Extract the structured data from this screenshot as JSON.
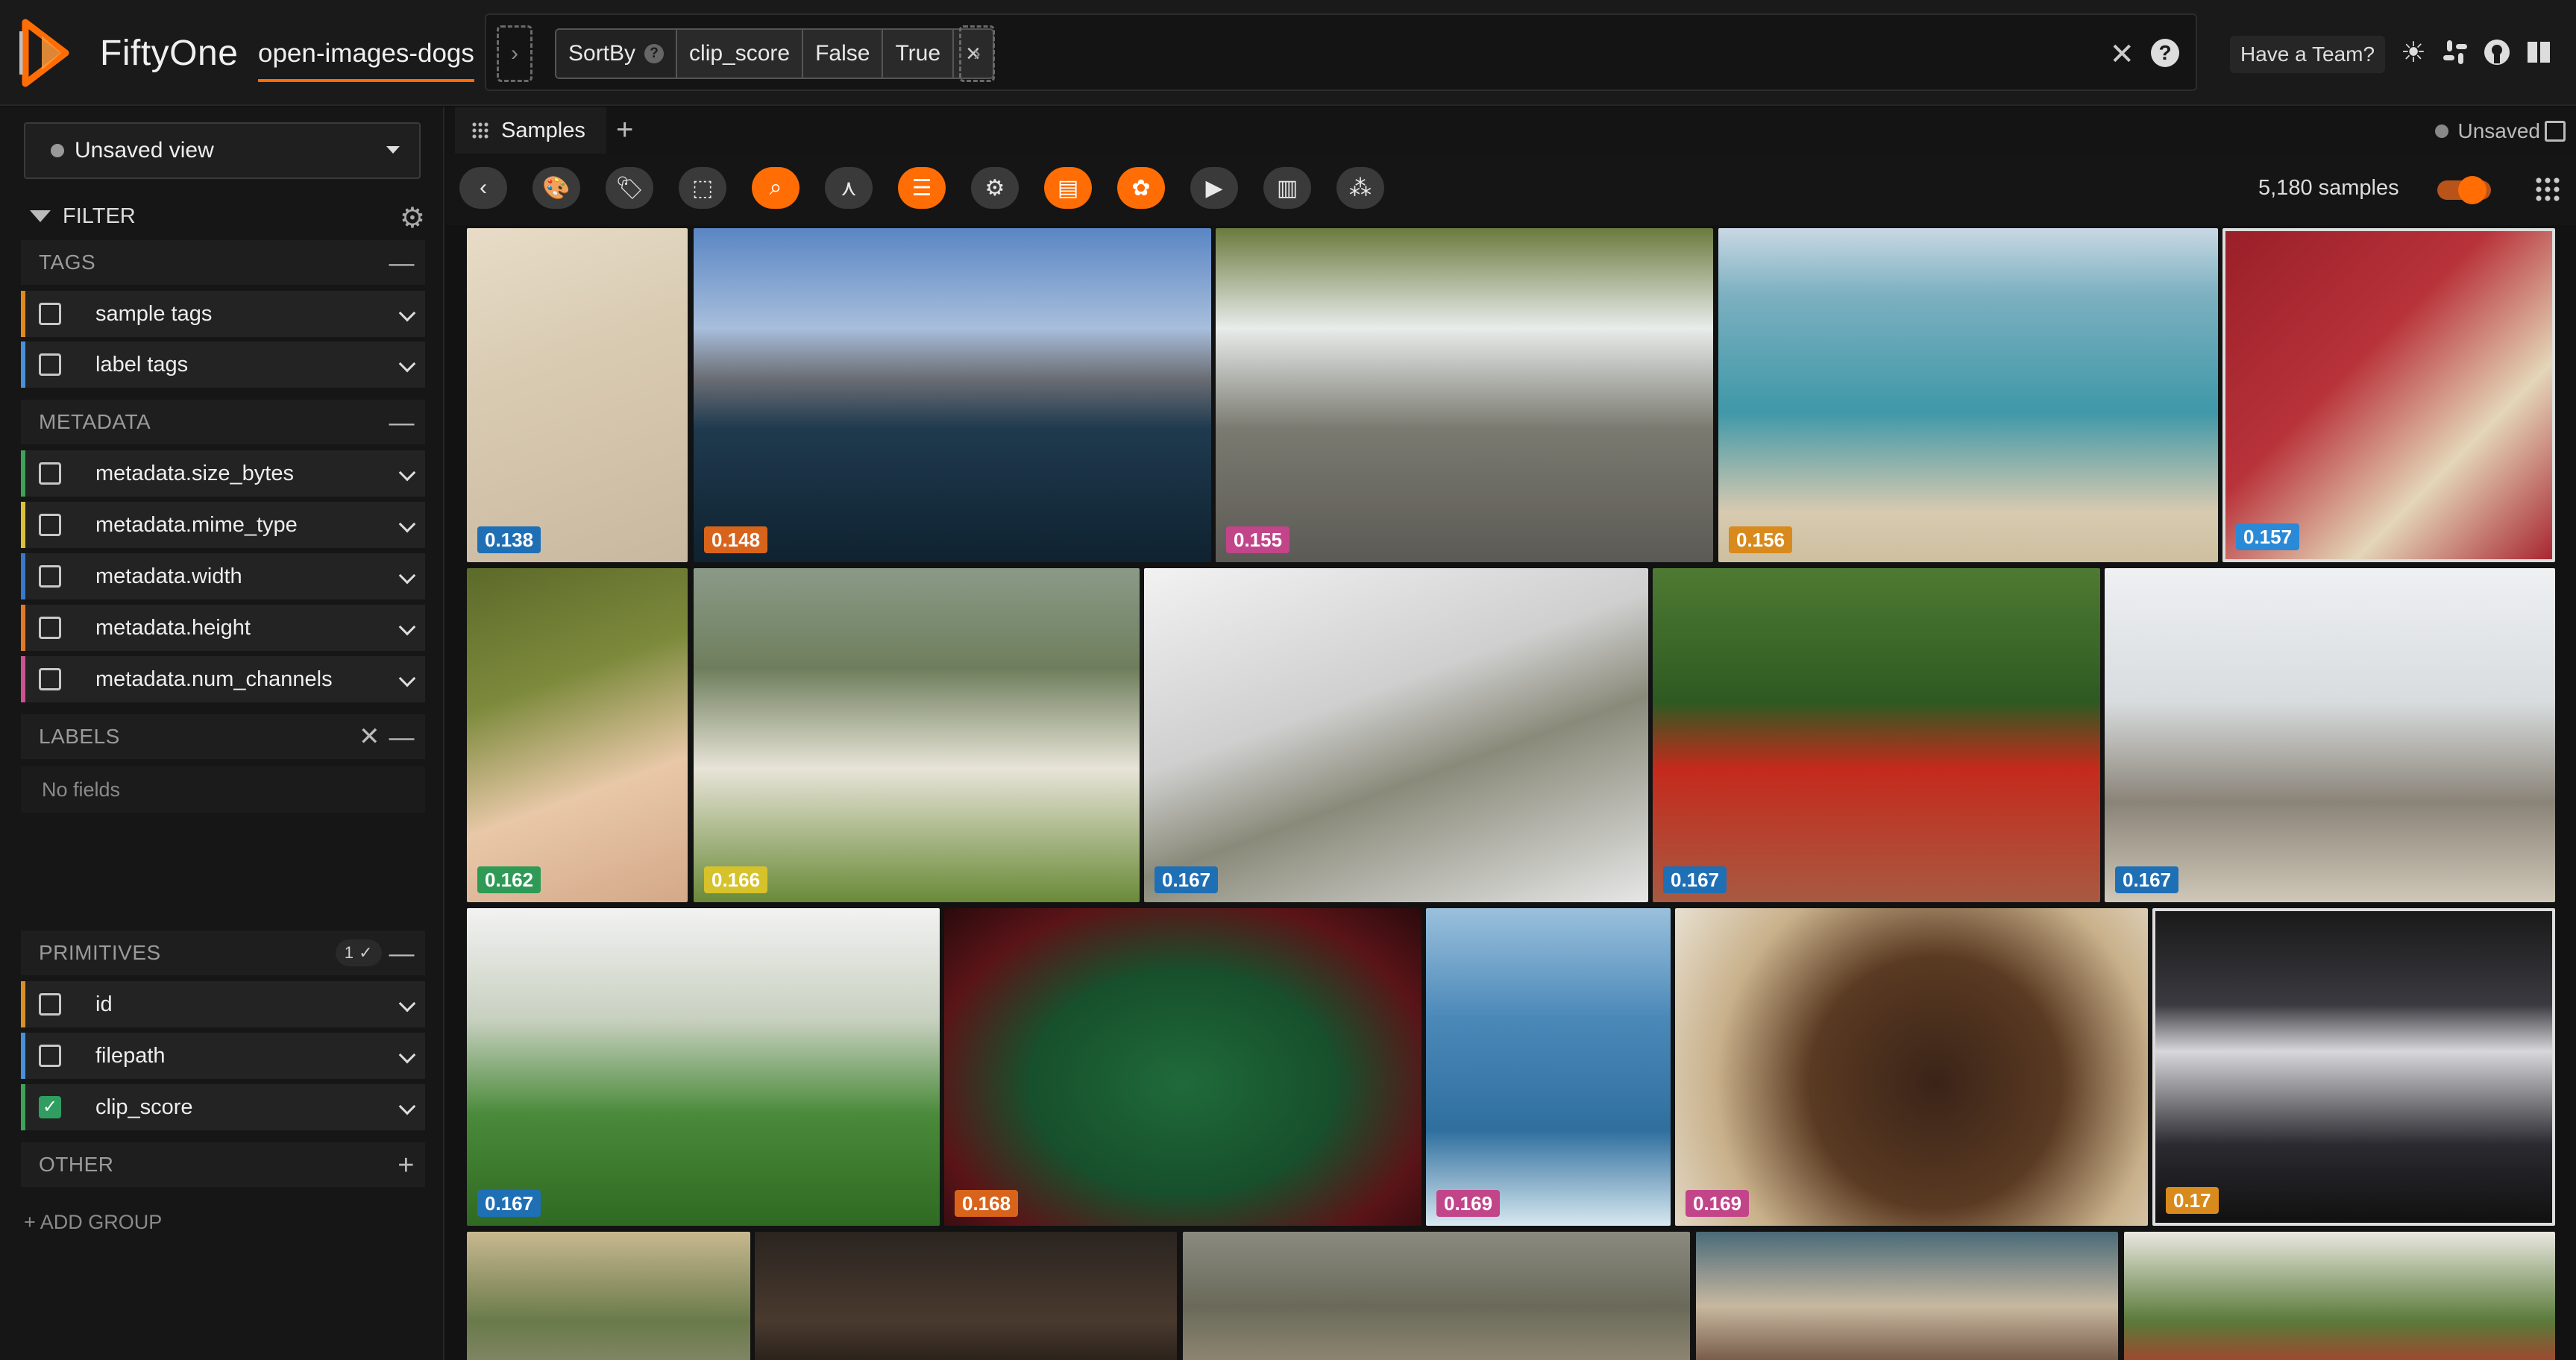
{
  "app": {
    "name": "FiftyOne",
    "dataset": "open-images-dogs"
  },
  "viewbar": {
    "stage": {
      "name": "SortBy",
      "params": [
        "clip_score",
        "False",
        "True"
      ]
    },
    "help_mark": "?",
    "close_mark": "×"
  },
  "header": {
    "team_button": "Have a Team?"
  },
  "sidebar": {
    "view_select": "Unsaved view",
    "filter_title": "FILTER",
    "groups": {
      "tags": {
        "title": "TAGS",
        "items": [
          "sample tags",
          "label tags"
        ]
      },
      "metadata": {
        "title": "METADATA",
        "items": [
          "metadata.size_bytes",
          "metadata.mime_type",
          "metadata.width",
          "metadata.height",
          "metadata.num_channels"
        ]
      },
      "labels": {
        "title": "LABELS",
        "empty": "No fields"
      },
      "primitives": {
        "title": "PRIMITIVES",
        "badge": "1 ✓",
        "items": [
          "id",
          "filepath",
          "clip_score"
        ]
      },
      "other": {
        "title": "OTHER"
      }
    },
    "add_group": "+ ADD GROUP",
    "field_colors": {
      "sample_tags": "#e08a1e",
      "label_tags": "#4a8fd8",
      "size_bytes": "#3fa15a",
      "mime_type": "#d9c23a",
      "width": "#3a78c9",
      "height": "#e07a2a",
      "num_channels": "#c9548f",
      "id": "#d8902a",
      "filepath": "#4a8fd8",
      "clip_score": "#3fa15a"
    },
    "checked": {
      "clip_score": true
    }
  },
  "tabs": {
    "samples": "Samples",
    "add": "+",
    "status": "Unsaved"
  },
  "toolbar": {
    "icons": [
      "back-icon",
      "palette-icon",
      "tag-icon",
      "select-icon",
      "search-icon",
      "similarity-icon",
      "list-icon",
      "settings-icon",
      "browse-operations-icon",
      "openai-icon",
      "video-icon",
      "chart-icon",
      "embeddings-icon"
    ],
    "count": "5,180 samples",
    "accent": "#ff6d04"
  },
  "grid": {
    "tiles": [
      {
        "score": "0.138",
        "badge": "#1f6fb5",
        "bg": "linear-gradient(160deg,#e8dcc8 0%,#d9cbb2 40%,#c9b8a0 100%)"
      },
      {
        "score": "0.148",
        "badge": "#d8641c",
        "bg": "linear-gradient(180deg,#5a86c4 0%,#a8bedc 30%,#6b6e74 45%,#1f3a4f 60%,#0f2230 100%)"
      },
      {
        "score": "0.155",
        "badge": "#c2458a",
        "bg": "linear-gradient(180deg,#6b7a3e 0%,#e8ecea 30%,#7a7a70 60%,#5c5a55 100%)"
      },
      {
        "score": "0.156",
        "badge": "#d88a1c",
        "bg": "linear-gradient(180deg,#c8d8e4 0%,#7cb0c0 20%,#3f98a8 55%,#d8cab0 85%,#cdbf9e 100%)"
      },
      {
        "score": "0.157",
        "badge": "#2a8ad8",
        "bg": "linear-gradient(135deg,#9a1f28 0%,#b8323a 40%,#e4d6b8 70%,#a82630 100%)"
      },
      {
        "score": "0.162",
        "badge": "#2f9a55",
        "bg": "linear-gradient(160deg,#5c6a2a 0%,#7d8a3c 35%,#e8c8a8 65%,#d4a888 100%)"
      },
      {
        "score": "0.166",
        "badge": "#d6c22a",
        "bg": "linear-gradient(180deg,#8a9a88 0%,#6e7e5c 30%,#e8e4d8 60%,#6a8a38 100%)"
      },
      {
        "score": "0.167",
        "badge": "#1f6fb5",
        "bg": "linear-gradient(160deg,#f2f2f2 0%,#cfcfcf 40%,#8a8a7a 60%,#e6e6e6 100%)"
      },
      {
        "score": "0.167",
        "badge": "#1f6fb5",
        "bg": "linear-gradient(180deg,#4e7a32 0%,#2e5a22 40%,#c42a1c 60%,#a85a42 100%)"
      },
      {
        "score": "0.167",
        "badge": "#1f6fb5",
        "bg": "linear-gradient(180deg,#eef0f2 0%,#d8dcde 40%,#8a8478 70%,#cfc8b8 100%)"
      },
      {
        "score": "0.167",
        "badge": "#1f6fb5",
        "bg": "linear-gradient(180deg,#f2f2f2 0%,#c8d0c0 35%,#4a8a3a 65%,#2f6a22 100%)"
      },
      {
        "score": "0.168",
        "badge": "#d8641c",
        "bg": "radial-gradient(ellipse at 50% 55%,#1f6a3a 0%,#17502c 45%,#5a1418 75%,#2a0a0c 100%)"
      },
      {
        "score": "0.169",
        "badge": "#c2458a",
        "bg": "linear-gradient(180deg,#9ac0dc 0%,#4a88b8 35%,#2f6f9e 70%,#d8e8f0 100%)"
      },
      {
        "score": "0.169",
        "badge": "#c2458a",
        "bg": "radial-gradient(circle at 55% 55%,#3a2418 0%,#5a3a22 40%,#c8b08a 70%,#e8e0d0 100%)"
      },
      {
        "score": "0.17",
        "badge": "#d88a1c",
        "bg": "linear-gradient(180deg,#1a1a1a 0%,#3a3a40 30%,#d8d8dc 45%,#2a2a30 75%,#111 100%)"
      },
      {
        "score": "",
        "badge": "",
        "bg": "linear-gradient(180deg,#c8b890 0%,#6a7a4a 60%,#8a8a70 100%)"
      },
      {
        "score": "",
        "badge": "",
        "bg": "linear-gradient(180deg,#2a2420 0%,#4a3a2e 60%,#1a1612 100%)"
      },
      {
        "score": "",
        "badge": "",
        "bg": "linear-gradient(180deg,#8a8a80 0%,#6a6a5a 50%,#9a8e78 100%)"
      },
      {
        "score": "",
        "badge": "",
        "bg": "linear-gradient(180deg,#4a6a78 0%,#c8b8a0 50%,#5a3a2a 100%)"
      },
      {
        "score": "",
        "badge": "",
        "bg": "linear-gradient(180deg,#eae8e0 0%,#5a7a3a 60%,#c0302a 100%)"
      }
    ]
  }
}
